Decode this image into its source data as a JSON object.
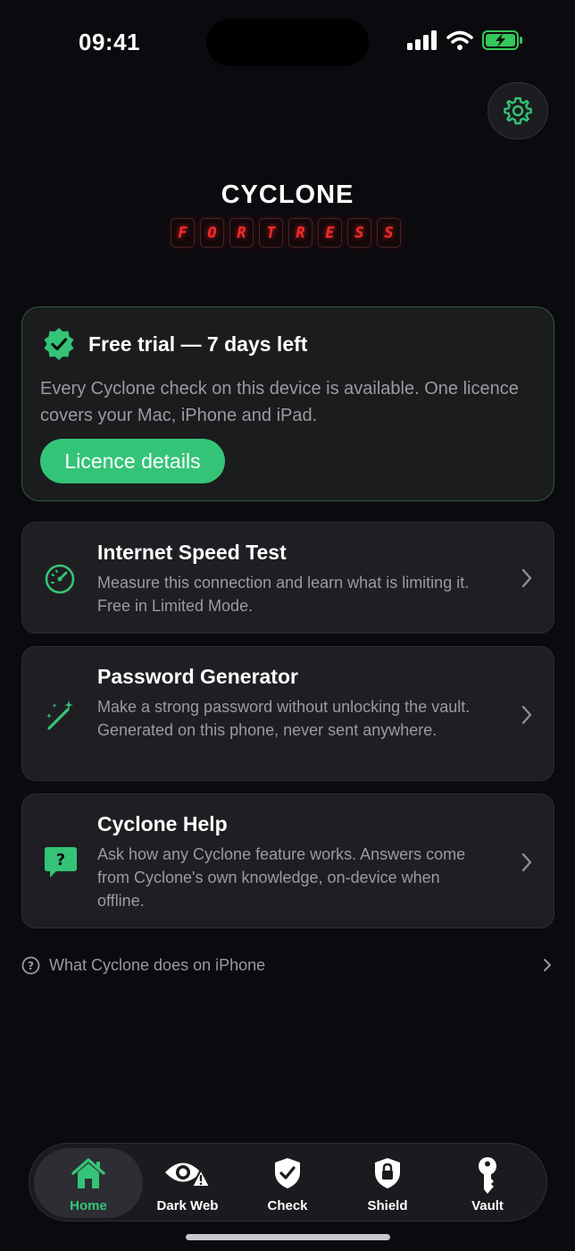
{
  "status_bar": {
    "time": "09:41",
    "icons": [
      "cellular-signal-icon",
      "wifi-icon",
      "battery-charging-icon"
    ],
    "battery_color": "#34c759"
  },
  "header": {
    "settings_icon": "gear-icon",
    "logo_title": "CYCLONE",
    "logo_subtitle_letters": [
      "F",
      "O",
      "R",
      "T",
      "R",
      "E",
      "S",
      "S"
    ]
  },
  "trial": {
    "icon": "verified-badge-icon",
    "title": "Free trial — 7 days left",
    "description": "Every Cyclone check on this device is available. One licence covers your Mac, iPhone and iPad.",
    "button_label": "Licence details"
  },
  "features": [
    {
      "icon": "speedometer-icon",
      "title": "Internet Speed Test",
      "description": "Measure this connection and learn what is limiting it. Free in Limited Mode."
    },
    {
      "icon": "magic-wand-icon",
      "title": "Password Generator",
      "description": "Make a strong password without unlocking the vault. Generated on this phone, never sent anywhere."
    },
    {
      "icon": "help-bubble-icon",
      "title": "Cyclone Help",
      "description": "Ask how any Cyclone feature works. Answers come from Cyclone's own knowledge, on-device when offline."
    }
  ],
  "help_link": {
    "icon": "question-circle-icon",
    "text": "What Cyclone does on iPhone"
  },
  "tabs": [
    {
      "label": "Home",
      "icon": "house-icon",
      "active": true
    },
    {
      "label": "Dark Web",
      "icon": "eye-warning-icon",
      "active": false
    },
    {
      "label": "Check",
      "icon": "shield-check-icon",
      "active": false
    },
    {
      "label": "Shield",
      "icon": "shield-lock-icon",
      "active": false
    },
    {
      "label": "Vault",
      "icon": "key-icon",
      "active": false
    }
  ],
  "colors": {
    "background": "#0b0b0f",
    "accent": "#34c477",
    "logo_red": "#ff2a2a",
    "card": "#1f1f23",
    "muted_text": "#9a9aa0"
  }
}
